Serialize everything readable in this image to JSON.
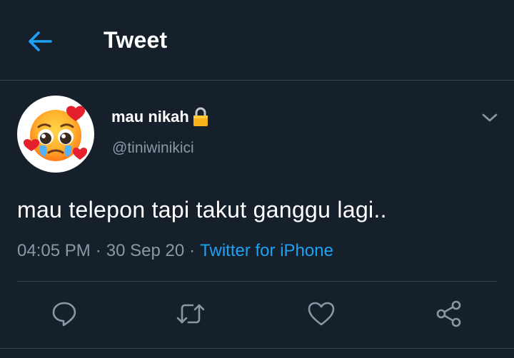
{
  "header": {
    "title": "Tweet",
    "back_icon": "arrow-left-icon"
  },
  "tweet": {
    "avatar_icon": "pleading-face-hearts-avatar",
    "display_name": "mau nikah",
    "protected_icon": "lock-icon",
    "handle": "@tiniwinikici",
    "more_icon": "chevron-down-icon",
    "text": "mau telepon tapi takut ganggu lagi..",
    "time": "04:05 PM",
    "separator": "·",
    "date": "30 Sep 20",
    "source": "Twitter for iPhone"
  },
  "actions": [
    {
      "icon": "reply-icon"
    },
    {
      "icon": "retweet-icon"
    },
    {
      "icon": "like-icon"
    },
    {
      "icon": "share-icon"
    }
  ],
  "colors": {
    "background": "#15202b",
    "accent": "#1da1f2",
    "secondary_text": "#8899a6",
    "divider": "#38444d"
  }
}
